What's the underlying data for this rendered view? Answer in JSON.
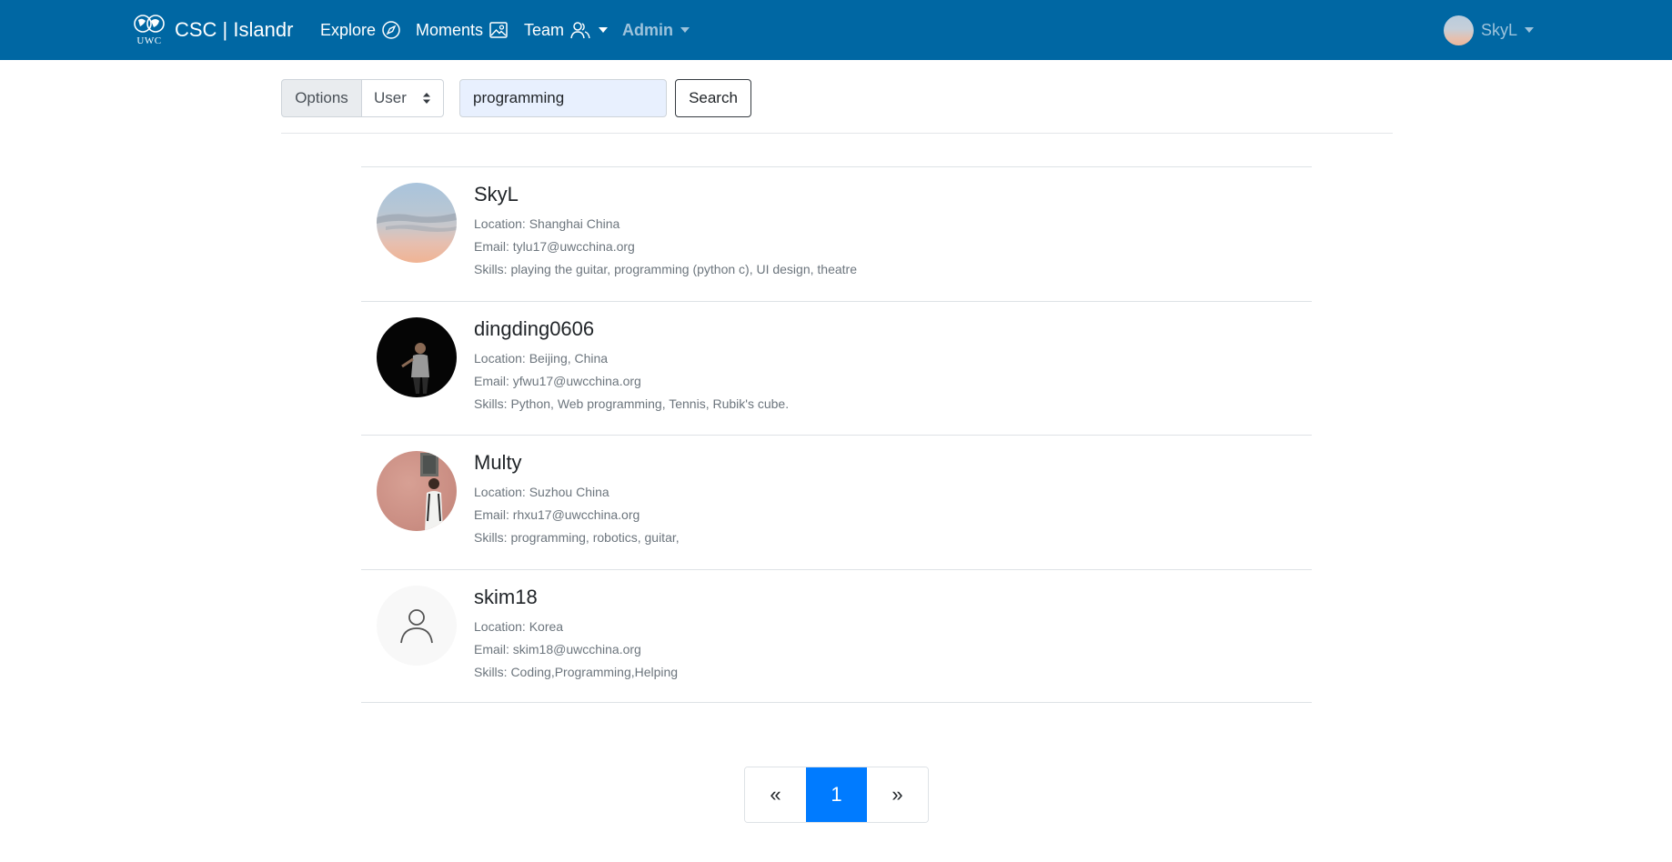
{
  "navbar": {
    "logo_text": "UWC",
    "brand": "CSC | Islandr",
    "items": [
      {
        "label": "Explore",
        "icon": "compass-icon"
      },
      {
        "label": "Moments",
        "icon": "image-icon"
      },
      {
        "label": "Team",
        "icon": "people-icon"
      },
      {
        "label": "Admin"
      }
    ],
    "user": {
      "name": "SkyL"
    },
    "colors": {
      "background": "#0067a3",
      "muted_link": "#9dc3dc"
    }
  },
  "search": {
    "options_label": "Options",
    "type_selected": "User",
    "query": "programming",
    "button_label": "Search"
  },
  "results": [
    {
      "name": "SkyL",
      "location": "Location: Shanghai China",
      "email": "Email: tylu17@uwcchina.org",
      "skills": "Skills: playing the guitar, programming (python c), UI design, theatre"
    },
    {
      "name": "dingding0606",
      "location": "Location: Beijing, China",
      "email": "Email: yfwu17@uwcchina.org",
      "skills": "Skills: Python, Web programming, Tennis, Rubik's cube."
    },
    {
      "name": "Multy",
      "location": "Location: Suzhou China",
      "email": "Email: rhxu17@uwcchina.org",
      "skills": "Skills: programming, robotics, guitar,"
    },
    {
      "name": "skim18",
      "location": "Location: Korea",
      "email": "Email: skim18@uwcchina.org",
      "skills": "Skills: Coding,Programming,Helping"
    }
  ],
  "pagination": {
    "prev": "«",
    "current": "1",
    "next": "»",
    "active_color": "#007bff"
  }
}
